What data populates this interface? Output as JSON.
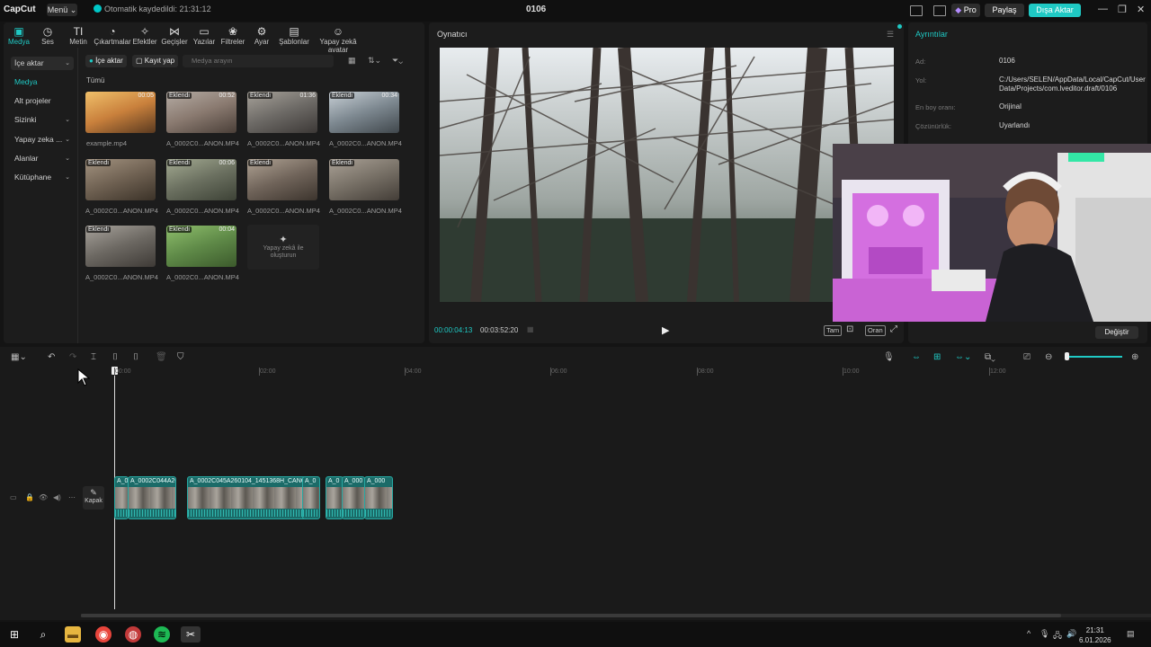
{
  "titlebar": {
    "logo": "CapCut",
    "menu_label": "Menü",
    "autosave": "Otomatik kaydedildi: 21:31:12",
    "project_title": "0106",
    "pro_label": "Pro",
    "share_label": "Paylaş",
    "export_label": "Dışa Aktar"
  },
  "toolbar": [
    {
      "icon": "media-icon",
      "label": "Medya"
    },
    {
      "icon": "audio-icon",
      "label": "Ses"
    },
    {
      "icon": "text-icon",
      "label": "Metin"
    },
    {
      "icon": "sticker-icon",
      "label": "Çıkartmalar"
    },
    {
      "icon": "effects-icon",
      "label": "Efektler"
    },
    {
      "icon": "transitions-icon",
      "label": "Geçişler"
    },
    {
      "icon": "captions-icon",
      "label": "Yazılar"
    },
    {
      "icon": "filters-icon",
      "label": "Filtreler"
    },
    {
      "icon": "adjust-icon",
      "label": "Ayar"
    },
    {
      "icon": "templates-icon",
      "label": "Şablonlar"
    },
    {
      "icon": "ai-avatar-icon",
      "label": "Yapay zekâ avatar"
    }
  ],
  "sidebar": [
    {
      "label": "İçe aktar",
      "chev": "⌄"
    },
    {
      "label": "Medya",
      "chev": ""
    },
    {
      "label": "Alt projeler",
      "chev": ""
    },
    {
      "label": "Sizinki",
      "chev": "⌄"
    },
    {
      "label": "Yapay zeka ...",
      "chev": "⌄"
    },
    {
      "label": "Alanlar",
      "chev": "⌄"
    },
    {
      "label": "Kütüphane",
      "chev": "⌄"
    }
  ],
  "media": {
    "import_btn": "İçe aktar",
    "record_btn": "Kayıt yap",
    "search_placeholder": "Medya arayın",
    "filter_all": "Tümü",
    "ai_create": "Yapay zekâ ile oluşturun",
    "items": [
      {
        "name": "example.mp4",
        "badge": "",
        "duration": "00:05"
      },
      {
        "name": "A_0002C0...ANON.MP4",
        "badge": "Eklendi",
        "duration": "00:52"
      },
      {
        "name": "A_0002C0...ANON.MP4",
        "badge": "Eklendi",
        "duration": "01:36"
      },
      {
        "name": "A_0002C0...ANON.MP4",
        "badge": "Eklendi",
        "duration": "00:34"
      },
      {
        "name": "A_0002C0...ANON.MP4",
        "badge": "Eklendi",
        "duration": ""
      },
      {
        "name": "A_0002C0...ANON.MP4",
        "badge": "Eklendi",
        "duration": "00:06"
      },
      {
        "name": "A_0002C0...ANON.MP4",
        "badge": "Eklendi",
        "duration": ""
      },
      {
        "name": "A_0002C0...ANON.MP4",
        "badge": "Eklendi",
        "duration": ""
      },
      {
        "name": "A_0002C0...ANON.MP4",
        "badge": "Eklendi",
        "duration": ""
      },
      {
        "name": "A_0002C0...ANON.MP4",
        "badge": "Eklendi",
        "duration": "00:04"
      }
    ]
  },
  "player": {
    "title": "Oynatıcı",
    "time_current": "00:00:04:13",
    "time_total": "00:03:52:20",
    "btn_full": "Tam",
    "btn_ratio": "Oran"
  },
  "details": {
    "title": "Ayrıntılar",
    "name_key": "Ad:",
    "name_val": "0106",
    "path_key": "Yol:",
    "path_val": "C:/Users/SELEN/AppData/Local/CapCut/User Data/Projects/com.lveditor.draft/0106",
    "ratio_key": "En boy oranı:",
    "ratio_val": "Orijinal",
    "res_key": "Çözünürlük:",
    "res_val": "Uyarlandı",
    "change_btn": "Değiştir"
  },
  "timeline": {
    "ruler": [
      "00:00",
      "02:00",
      "04:00",
      "06:00",
      "08:00",
      "10:00",
      "12:00"
    ],
    "cover_label": "Kapak",
    "clips": [
      {
        "label": "A_0"
      },
      {
        "label": "A_0002C044A260104_"
      },
      {
        "label": "A_0002C045A260104_1451368H_CANON"
      },
      {
        "label": "A_0"
      },
      {
        "label": "A_0"
      },
      {
        "label": "A_000"
      },
      {
        "label": "A_000"
      }
    ]
  },
  "taskbar": {
    "time": "21:31",
    "date": "6.01.2026"
  },
  "colors": {
    "accent": "#1fc9c4",
    "clip": "#1b6b68"
  }
}
